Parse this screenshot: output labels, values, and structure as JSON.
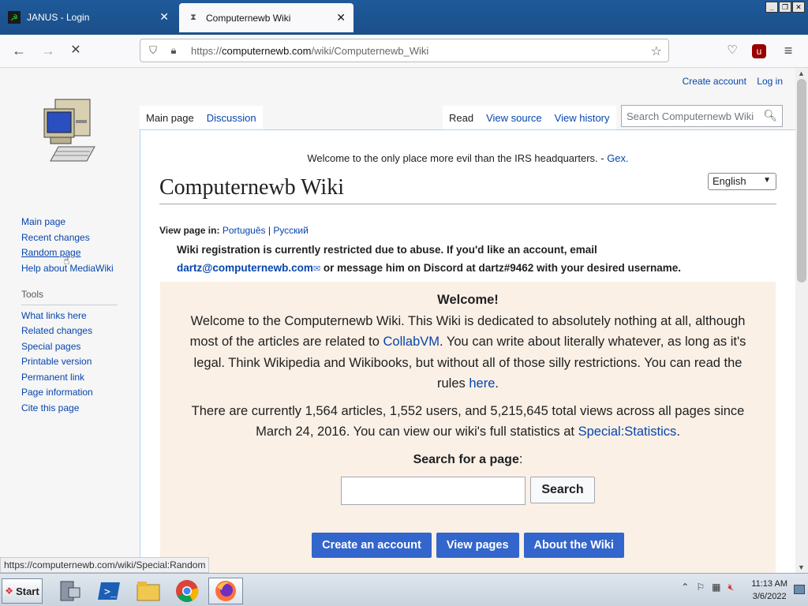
{
  "browser": {
    "tabs": [
      {
        "label": "JANUS - Login",
        "active": false,
        "icon": "janus-icon"
      },
      {
        "label": "Computernewb Wiki",
        "active": true,
        "icon": "hourglass-icon"
      }
    ],
    "window_controls": [
      "minimize",
      "restore",
      "close"
    ],
    "url": {
      "prefix": "https://",
      "domain": "computernewb.com",
      "path": "/wiki/Computernewb_Wiki"
    }
  },
  "wiki": {
    "user_links": [
      "Create account",
      "Log in"
    ],
    "page_tabs": [
      "Main page",
      "Discussion"
    ],
    "view_tabs": [
      "Read",
      "View source",
      "View history"
    ],
    "search_placeholder": "Search Computernewb Wiki",
    "sidebar": {
      "nav": [
        "Main page",
        "Recent changes",
        "Random page",
        "Help about MediaWiki"
      ],
      "tools_header": "Tools",
      "tools": [
        "What links here",
        "Related changes",
        "Special pages",
        "Printable version",
        "Permanent link",
        "Page information",
        "Cite this page"
      ]
    },
    "motd": "Welcome to the only place more evil than the IRS headquarters. - ",
    "motd_link": "Gex.",
    "title": "Computernewb Wiki",
    "language": "English",
    "view_in_label": "View page in:",
    "view_in_langs": [
      "Português",
      "Русский"
    ],
    "notice_1": "Wiki registration is currently restricted due to abuse. If you'd like an account, email",
    "notice_email": "dartz@computernewb.com",
    "notice_2": " or message him on Discord at dartz#9462 with your desired username.",
    "welcome_title": "Welcome!",
    "welcome_p1a": "Welcome to the Computernewb Wiki. This Wiki is dedicated to absolutely nothing at all, although most of the articles are related to ",
    "welcome_link_collab": "CollabVM",
    "welcome_p1b": ". You can write about literally whatever, as long as it's legal. Think Wikipedia and Wikibooks, but without all of those silly restrictions. You can read the rules ",
    "welcome_link_here": "here",
    "welcome_p2a": "There are currently 1,564 articles, 1,552 users, and 5,215,645 total views across all pages since March 24, 2016. You can view our wiki's full statistics at ",
    "welcome_link_stats": "Special:Statistics",
    "search_label": "Search for a page",
    "search_button": "Search",
    "buttons": [
      "Create an account",
      "View pages",
      "About the Wiki"
    ]
  },
  "status_url": "https://computernewb.com/wiki/Special:Random",
  "taskbar": {
    "start_label": "Start",
    "apps": [
      "server-manager-icon",
      "powershell-icon",
      "explorer-icon",
      "chrome-icon",
      "firefox-icon"
    ],
    "time": "11:13 AM",
    "date": "3/6/2022"
  }
}
